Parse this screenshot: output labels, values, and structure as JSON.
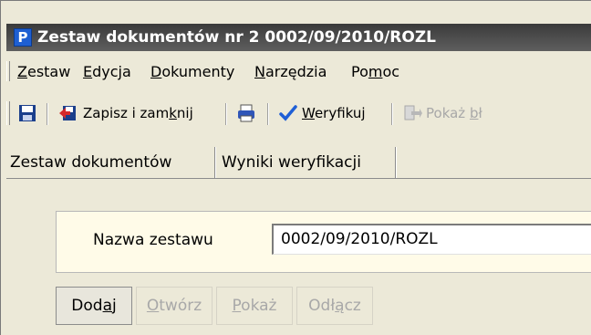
{
  "window": {
    "title": "Zestaw dokumentów nr 2 0002/09/2010/ROZL",
    "app_icon_letter": "P"
  },
  "menu": {
    "items": [
      {
        "label": "Zestaw",
        "mnemonic": "Z"
      },
      {
        "label": "Edycja",
        "mnemonic": "E"
      },
      {
        "label": "Dokumenty",
        "mnemonic": "D"
      },
      {
        "label": "Narzędzia",
        "mnemonic": "N"
      },
      {
        "label": "Pomoc",
        "mnemonic": "m"
      }
    ]
  },
  "toolbar": {
    "save_icon": "floppy-disk-icon",
    "save_close_label": "Zapisz i zamknij",
    "save_close_icon": "save-close-icon",
    "print_icon": "printer-icon",
    "verify_label": "Weryfikuj",
    "verify_icon": "checkmark-icon",
    "show_errors_label": "Pokaż bł",
    "show_errors_icon": "show-errors-icon"
  },
  "tabs": [
    {
      "label": "Zestaw dokumentów",
      "active": true
    },
    {
      "label": "Wyniki weryfikacji",
      "active": false
    }
  ],
  "form": {
    "name_label": "Nazwa zestawu",
    "name_value": "0002/09/2010/ROZL"
  },
  "buttons": {
    "add": "Dodaj",
    "open": "Otwórz",
    "show": "Pokaż",
    "detach": "Odłącz"
  }
}
